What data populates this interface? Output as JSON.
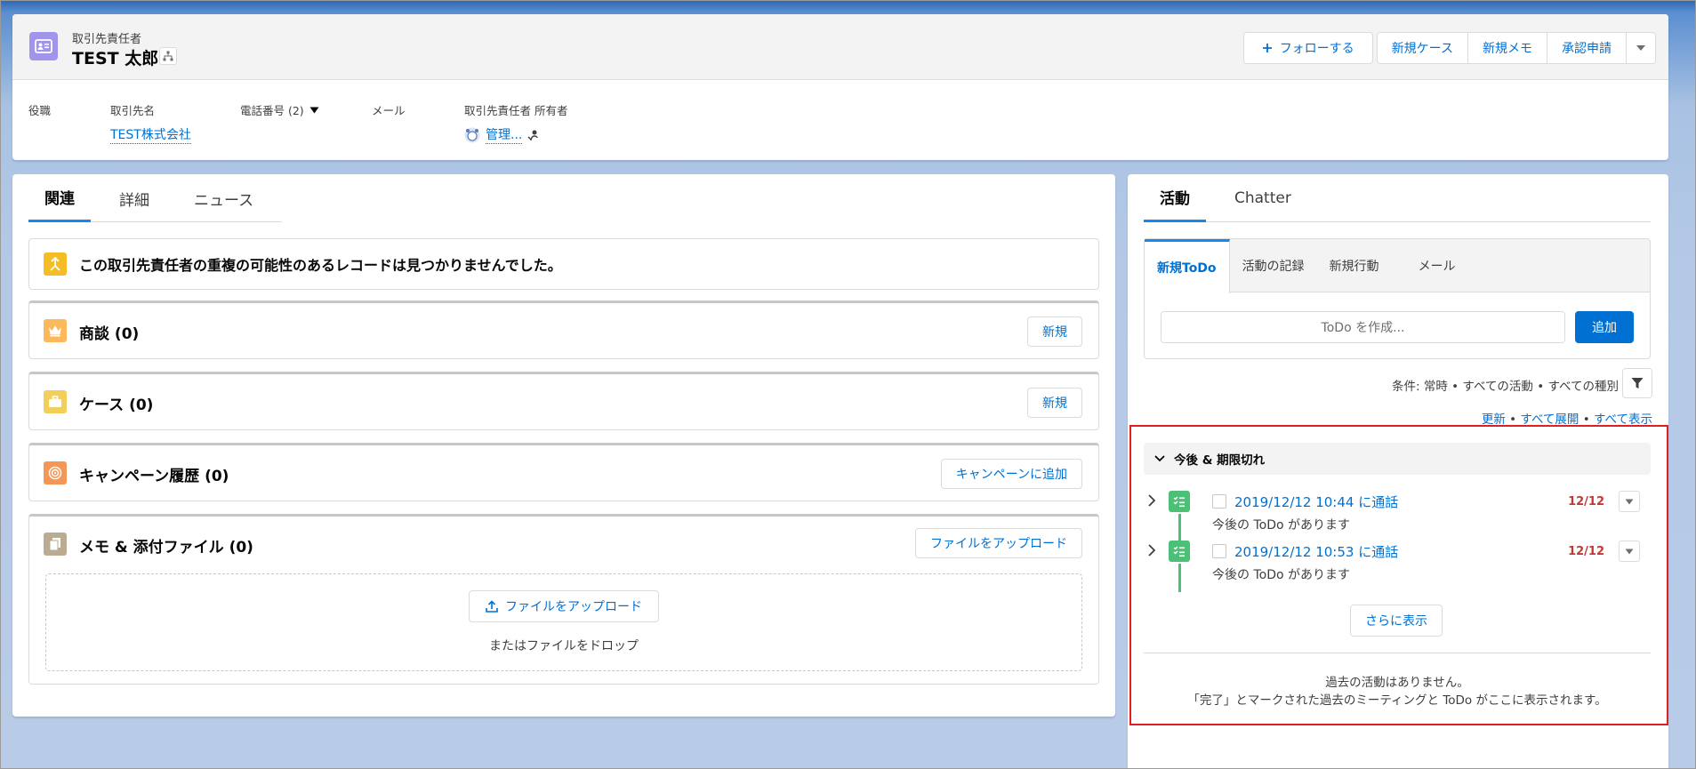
{
  "header": {
    "object_type": "取引先責任者",
    "record_name": "TEST 太郎",
    "actions": {
      "follow": "フォローする",
      "new_case": "新規ケース",
      "new_note": "新規メモ",
      "approval": "承認申請"
    },
    "fields": {
      "title_label": "役職",
      "account_label": "取引先名",
      "account_value": "TEST株式会社",
      "phone_label": "電話番号 (2)",
      "email_label": "メール",
      "owner_label": "取引先責任者 所有者",
      "owner_value": "管理..."
    }
  },
  "left": {
    "tabs": [
      "関連",
      "詳細",
      "ニュース"
    ],
    "duplicate_message": "この取引先責任者の重複の可能性のあるレコードは見つかりませんでした。",
    "related": {
      "opportunities": {
        "title": "商談 (0)",
        "button": "新規"
      },
      "cases": {
        "title": "ケース (0)",
        "button": "新規"
      },
      "campaigns": {
        "title": "キャンペーン履歴 (0)",
        "button": "キャンペーンに追加"
      },
      "files": {
        "title": "メモ & 添付ファイル (0)",
        "button": "ファイルをアップロード",
        "drop_button": "ファイルをアップロード",
        "drop_text": "またはファイルをドロップ"
      }
    }
  },
  "right": {
    "tabs": [
      "活動",
      "Chatter"
    ],
    "composer_tabs": [
      "新規ToDo",
      "活動の記録",
      "新規行動",
      "メール"
    ],
    "todo_placeholder": "ToDo を作成...",
    "add_button": "追加",
    "filter_text": "条件: 常時 • すべての活動 • すべての種別",
    "links": [
      "更新",
      "すべて展開",
      "すべて表示"
    ],
    "upcoming_header": "今後 & 期限切れ",
    "items": [
      {
        "subject": "2019/12/12 10:44 に通話",
        "desc": "今後の ToDo があります",
        "date": "12/12"
      },
      {
        "subject": "2019/12/12 10:53 に通話",
        "desc": "今後の ToDo があります",
        "date": "12/12"
      }
    ],
    "more_button": "さらに表示",
    "past_line1": "過去の活動はありません。",
    "past_line2": "「完了」とマークされた過去のミーティングと ToDo がここに表示されます。"
  },
  "colors": {
    "accent": "#0070d2",
    "contact_icon": "#a094ed",
    "task_icon": "#4bc076",
    "overdue": "#c23934",
    "highlight_box": "#e02020"
  }
}
